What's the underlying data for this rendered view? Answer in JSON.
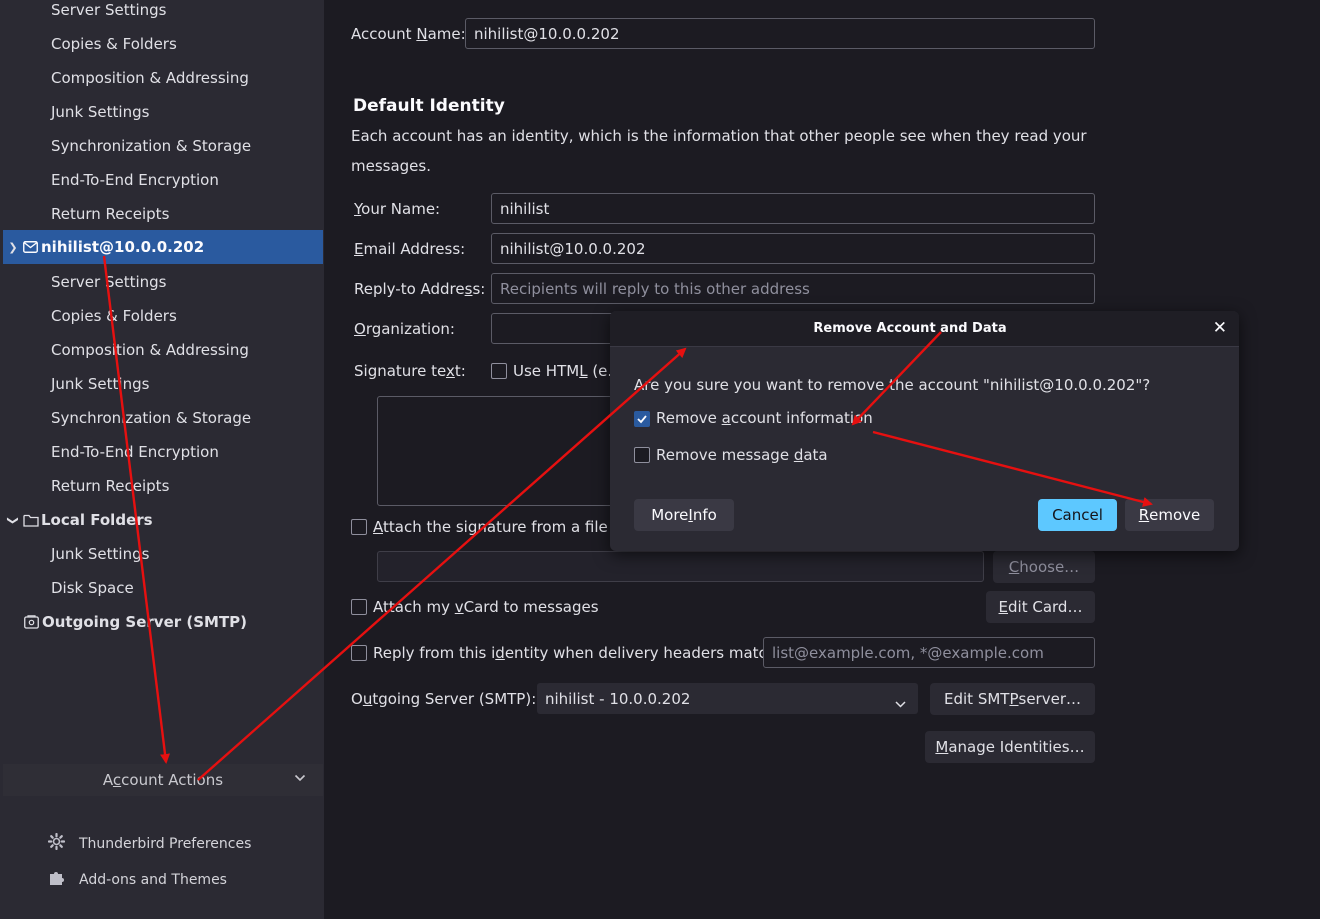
{
  "sidebar": {
    "account1_items": [
      "Server Settings",
      "Copies & Folders",
      "Composition & Addressing",
      "Junk Settings",
      "Synchronization & Storage",
      "End-To-End Encryption",
      "Return Receipts"
    ],
    "account2": {
      "name": "nihilist@10.0.0.202",
      "items": [
        "Server Settings",
        "Copies & Folders",
        "Composition & Addressing",
        "Junk Settings",
        "Synchronization & Storage",
        "End-To-End Encryption",
        "Return Receipts"
      ]
    },
    "local_folders": {
      "name": "Local Folders",
      "items": [
        "Junk Settings",
        "Disk Space"
      ]
    },
    "outgoing_server": "Outgoing Server (SMTP)",
    "account_actions": {
      "pre": "A",
      "key": "c",
      "post": "count Actions"
    },
    "preferences": "Thunderbird Preferences",
    "addons": "Add-ons and Themes"
  },
  "main": {
    "account_name": {
      "pre": "Account ",
      "key": "N",
      "post": "ame:",
      "value": "nihilist@10.0.0.202"
    },
    "identity_heading": "Default Identity",
    "identity_desc_line1": "Each account has an identity, which is the information that other people see when they read your",
    "identity_desc_line2": "messages.",
    "your_name": {
      "pre": "",
      "key": "Y",
      "post": "our Name:",
      "value": "nihilist"
    },
    "email": {
      "pre": "",
      "key": "E",
      "post": "mail Address:",
      "value": "nihilist@10.0.0.202"
    },
    "reply_to": {
      "pre": "Reply-to Addre",
      "key": "s",
      "post": "s:",
      "placeholder": "Recipients will reply to this other address"
    },
    "organization": {
      "pre": "",
      "key": "O",
      "post": "rganization:"
    },
    "signature": {
      "pre": "Signature te",
      "key": "x",
      "post": "t:"
    },
    "use_html": {
      "pre": "Use HTM",
      "key": "L",
      "post": " (e."
    },
    "attach_sig": {
      "pre": "",
      "key": "A",
      "post": "ttach the signature from a file in"
    },
    "choose_btn": {
      "pre": "",
      "key": "C",
      "post": "hoose…"
    },
    "attach_vcard": {
      "pre": "Attach my ",
      "key": "v",
      "post": "Card to messages"
    },
    "edit_card_btn": {
      "pre": "",
      "key": "E",
      "post": "dit Card…"
    },
    "reply_from": {
      "pre": "Reply from this i",
      "key": "d",
      "post": "entity when delivery headers match:",
      "placeholder": "list@example.com, *@example.com"
    },
    "smtp": {
      "pre": "O",
      "key": "u",
      "post": "tgoing Server (SMTP):",
      "value": "nihilist - 10.0.0.202"
    },
    "edit_smtp_btn": {
      "pre": "Edit SMT",
      "key": "P",
      "post": " server…"
    },
    "manage_btn": {
      "pre": "",
      "key": "M",
      "post": "anage Identities…"
    }
  },
  "dialog": {
    "title": "Remove Account and Data",
    "question": "Are you sure you want to remove the account \"nihilist@10.0.0.202\"?",
    "remove_info": {
      "pre": "Remove ",
      "key": "a",
      "post": "ccount information",
      "checked": true
    },
    "remove_data": {
      "pre": "Remove message ",
      "key": "d",
      "post": "ata",
      "checked": false
    },
    "more_info": {
      "pre": "More ",
      "key": "I",
      "post": "nfo"
    },
    "cancel": "Cancel",
    "remove": {
      "pre": "",
      "key": "R",
      "post": "emove"
    }
  },
  "colors": {
    "selected_account_bg": "#2a5a9f",
    "primary_button": "#5dc8ff",
    "checkbox_checked": "#2a5a9f",
    "annotation_arrow": "#e61010"
  }
}
